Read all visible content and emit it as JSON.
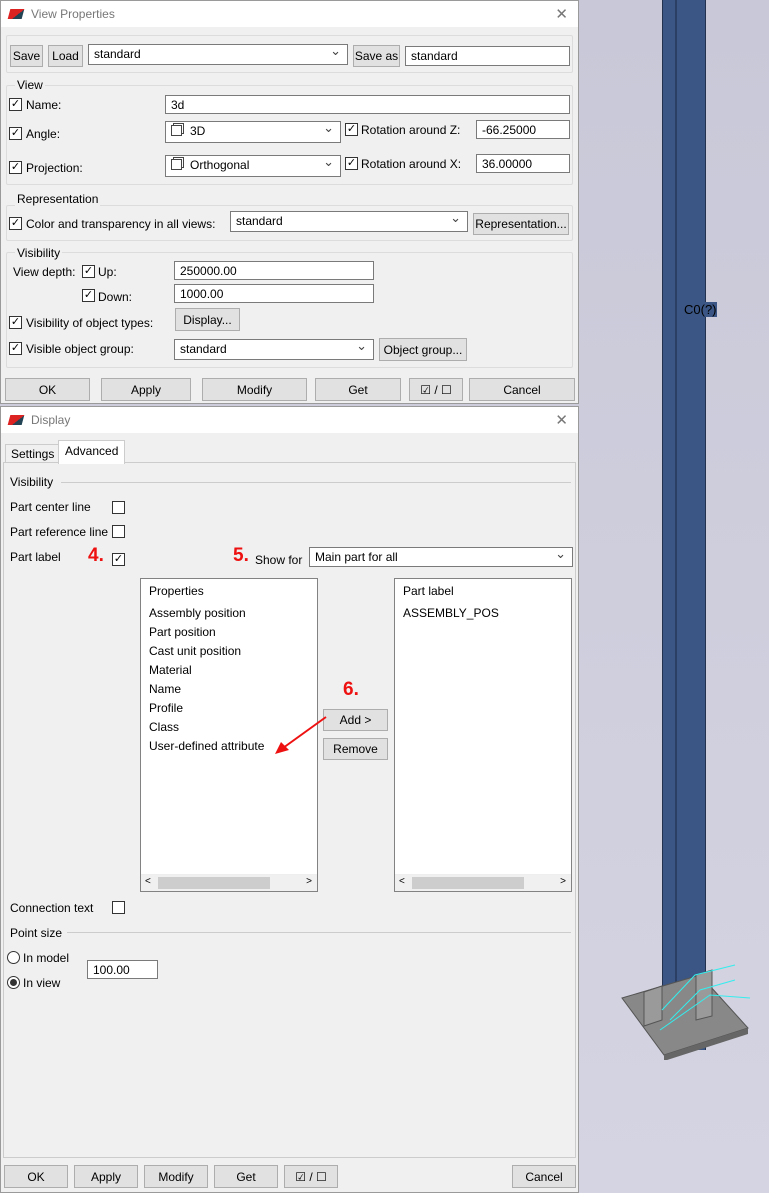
{
  "view_properties": {
    "title": "View Properties",
    "save": "Save",
    "load": "Load",
    "preset": "standard",
    "save_as": "Save as",
    "save_as_value": "standard",
    "view_group": "View",
    "name_label": "Name:",
    "name_value": "3d",
    "angle_label": "Angle:",
    "angle_value": "3D",
    "rot_z_label": "Rotation around Z:",
    "rot_z_value": "-66.25000",
    "projection_label": "Projection:",
    "projection_value": "Orthogonal",
    "rot_x_label": "Rotation around X:",
    "rot_x_value": "36.00000",
    "representation_group": "Representation",
    "color_label": "Color and transparency in all views:",
    "color_value": "standard",
    "representation_button": "Representation...",
    "visibility_group": "Visibility",
    "view_depth_label": "View depth:",
    "up_label": "Up:",
    "up_value": "250000.00",
    "down_label": "Down:",
    "down_value": "1000.00",
    "object_types_label": "Visibility of object types:",
    "display_button": "Display...",
    "object_group_label": "Visible object group:",
    "object_group_value": "standard",
    "object_group_button": "Object group...",
    "ok": "OK",
    "apply": "Apply",
    "modify": "Modify",
    "get": "Get",
    "toggle": "☑ / ☐",
    "cancel": "Cancel"
  },
  "display": {
    "title": "Display",
    "tabs": [
      "Settings",
      "Advanced"
    ],
    "visibility": "Visibility",
    "part_center_line": "Part center line",
    "part_reference_line": "Part reference line",
    "part_label": "Part label",
    "step4": "4.",
    "step5": "5.",
    "step6": "6.",
    "show_for_label": "Show for",
    "show_for_value": "Main part for all",
    "properties_header": "Properties",
    "properties": [
      "Assembly position",
      "Part position",
      "Cast unit position",
      "Material",
      "Name",
      "Profile",
      "Class",
      "User-defined attribute"
    ],
    "part_label_header": "Part label",
    "part_label_items": [
      "ASSEMBLY_POS"
    ],
    "add": "Add >",
    "remove": "Remove",
    "connection_text": "Connection text",
    "point_size": "Point size",
    "in_model": "In model",
    "in_view": "In view",
    "point_size_value": "100.00",
    "ok": "OK",
    "apply": "Apply",
    "modify": "Modify",
    "get": "Get",
    "toggle": "☑ / ☐",
    "cancel": "Cancel"
  },
  "model": {
    "column_label": "C0(?)"
  }
}
